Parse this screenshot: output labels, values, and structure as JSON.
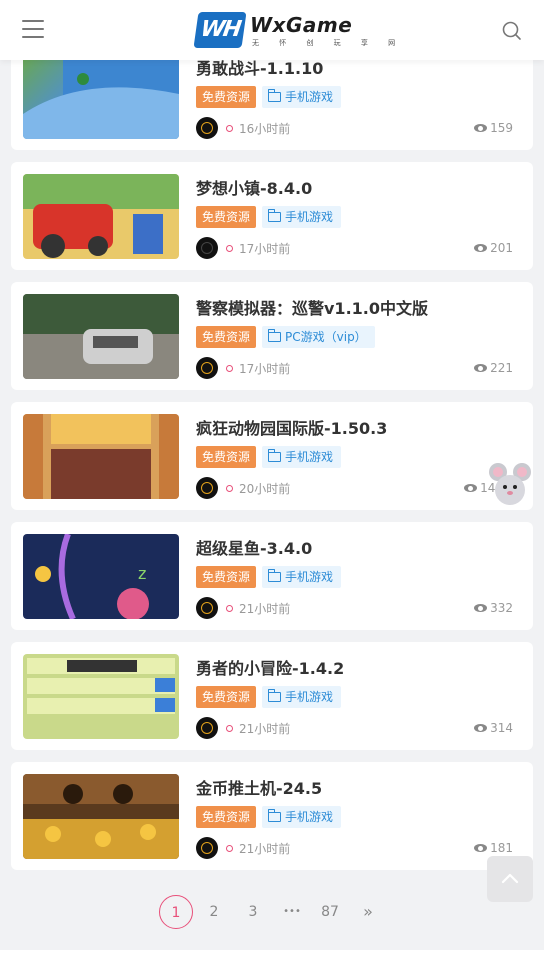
{
  "header": {
    "logo_mark": "WH",
    "logo_text": "WxGame",
    "logo_sub": "无 怀 创 玩 享 网"
  },
  "posts": [
    {
      "title": "勇敢战斗-1.1.10",
      "tag_free": "免费资源",
      "category": "手机游戏",
      "time": "16小时前",
      "views": "159"
    },
    {
      "title": "梦想小镇-8.4.0",
      "tag_free": "免费资源",
      "category": "手机游戏",
      "time": "17小时前",
      "views": "201"
    },
    {
      "title": "警察模拟器：巡警v1.1.0中文版",
      "tag_free": "免费资源",
      "category": "PC游戏（vip）",
      "time": "17小时前",
      "views": "221"
    },
    {
      "title": "疯狂动物园国际版-1.50.3",
      "tag_free": "免费资源",
      "category": "手机游戏",
      "time": "20小时前",
      "views": "146"
    },
    {
      "title": "超级星鱼-3.4.0",
      "tag_free": "免费资源",
      "category": "手机游戏",
      "time": "21小时前",
      "views": "332"
    },
    {
      "title": "勇者的小冒险-1.4.2",
      "tag_free": "免费资源",
      "category": "手机游戏",
      "time": "21小时前",
      "views": "314"
    },
    {
      "title": "金币推土机-24.5",
      "tag_free": "免费资源",
      "category": "手机游戏",
      "time": "21小时前",
      "views": "181"
    }
  ],
  "pagination": {
    "p1": "1",
    "p2": "2",
    "p3": "3",
    "ellipsis": "•••",
    "last": "87",
    "next": "»"
  }
}
